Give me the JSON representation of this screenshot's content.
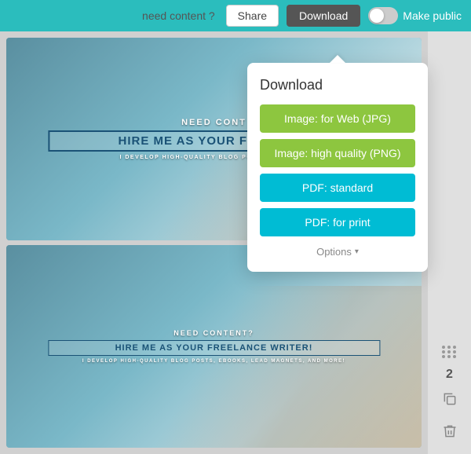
{
  "topbar": {
    "need_content_label": "need content ?",
    "share_label": "Share",
    "download_label": "Download",
    "make_public_label": "Make public"
  },
  "download_popup": {
    "title": "Download",
    "btn_jpg": "Image: for Web (JPG)",
    "btn_png": "Image: high quality (PNG)",
    "btn_pdf_standard": "PDF: standard",
    "btn_pdf_print": "PDF: for print",
    "btn_options": "Options"
  },
  "card1": {
    "subtitle_top": "NEED CONT",
    "title": "HIRE ME AS YOUR FREELANC",
    "subtitle_bottom": "I DEVELOP HIGH-QUALITY BLOG PO\nLEAD MAGNET"
  },
  "card2": {
    "subtitle_top": "NEED CONTENT?",
    "title": "HIRE ME AS YOUR FREELANCE WRITER!",
    "subtitle_bottom": "I DEVELOP HIGH-QUALITY BLOG POSTS, EBOOKS,\nLEAD MAGNETS, AND MORE!"
  },
  "sidebar": {
    "page_number": "2",
    "copy_icon": "⧉",
    "delete_icon": "🗑"
  }
}
